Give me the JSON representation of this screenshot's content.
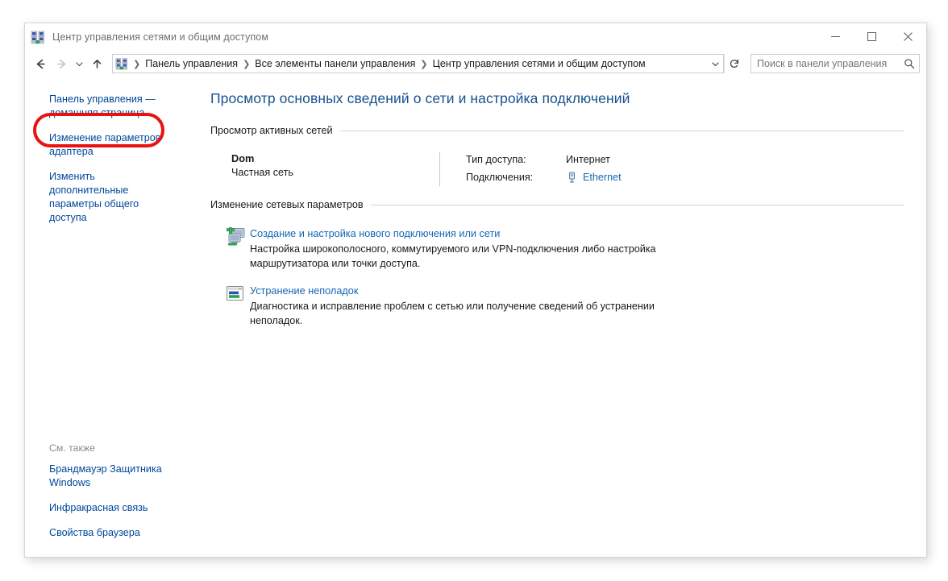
{
  "window": {
    "title": "Центр управления сетями и общим доступом",
    "icon": "network-icon",
    "controls": {
      "minimize": "minimize-button",
      "maximize": "maximize-button",
      "close": "close-button"
    }
  },
  "toolbar": {
    "back": "back-arrow-icon",
    "forward": "forward-arrow-icon",
    "recent": "chevron-down-icon",
    "up": "up-arrow-icon",
    "refresh": "refresh-icon",
    "breadcrumb": [
      "Панель управления",
      "Все элементы панели управления",
      "Центр управления сетями и общим доступом"
    ],
    "separator": "❯"
  },
  "search": {
    "placeholder": "Поиск в панели управления",
    "value": "",
    "icon": "search-icon"
  },
  "sidebar": {
    "items": [
      {
        "label": "Панель управления — домашняя страница",
        "highlighted": false
      },
      {
        "label": "Изменение параметров адаптера",
        "highlighted": true
      },
      {
        "label": "Изменить дополнительные параметры общего доступа",
        "highlighted": false
      }
    ],
    "see_also": {
      "title": "См. также",
      "items": [
        "Брандмауэр Защитника Windows",
        "Инфракрасная связь",
        "Свойства браузера"
      ]
    },
    "highlight_color": "#e8130f"
  },
  "content": {
    "page_title": "Просмотр основных сведений о сети и настройка подключений",
    "active_networks": {
      "heading": "Просмотр активных сетей",
      "network": {
        "name": "Dom",
        "type": "Частная сеть",
        "details": [
          {
            "key": "Тип доступа:",
            "value": "Интернет",
            "is_link": false
          },
          {
            "key": "Подключения:",
            "value": "Ethernet",
            "is_link": true,
            "icon": "ethernet-icon"
          }
        ]
      }
    },
    "change_settings": {
      "heading": "Изменение сетевых параметров",
      "tasks": [
        {
          "icon": "new-connection-icon",
          "link": "Создание и настройка нового подключения или сети",
          "description": "Настройка широкополосного, коммутируемого или VPN-подключения либо настройка маршрутизатора или точки доступа."
        },
        {
          "icon": "troubleshoot-icon",
          "link": "Устранение неполадок",
          "description": "Диагностика и исправление проблем с сетью или получение сведений об устранении неполадок."
        }
      ]
    }
  },
  "colors": {
    "title_blue": "#17518f",
    "link_blue": "#1667b3",
    "nav_blue": "#00479b",
    "highlight_red": "#e8130f"
  }
}
